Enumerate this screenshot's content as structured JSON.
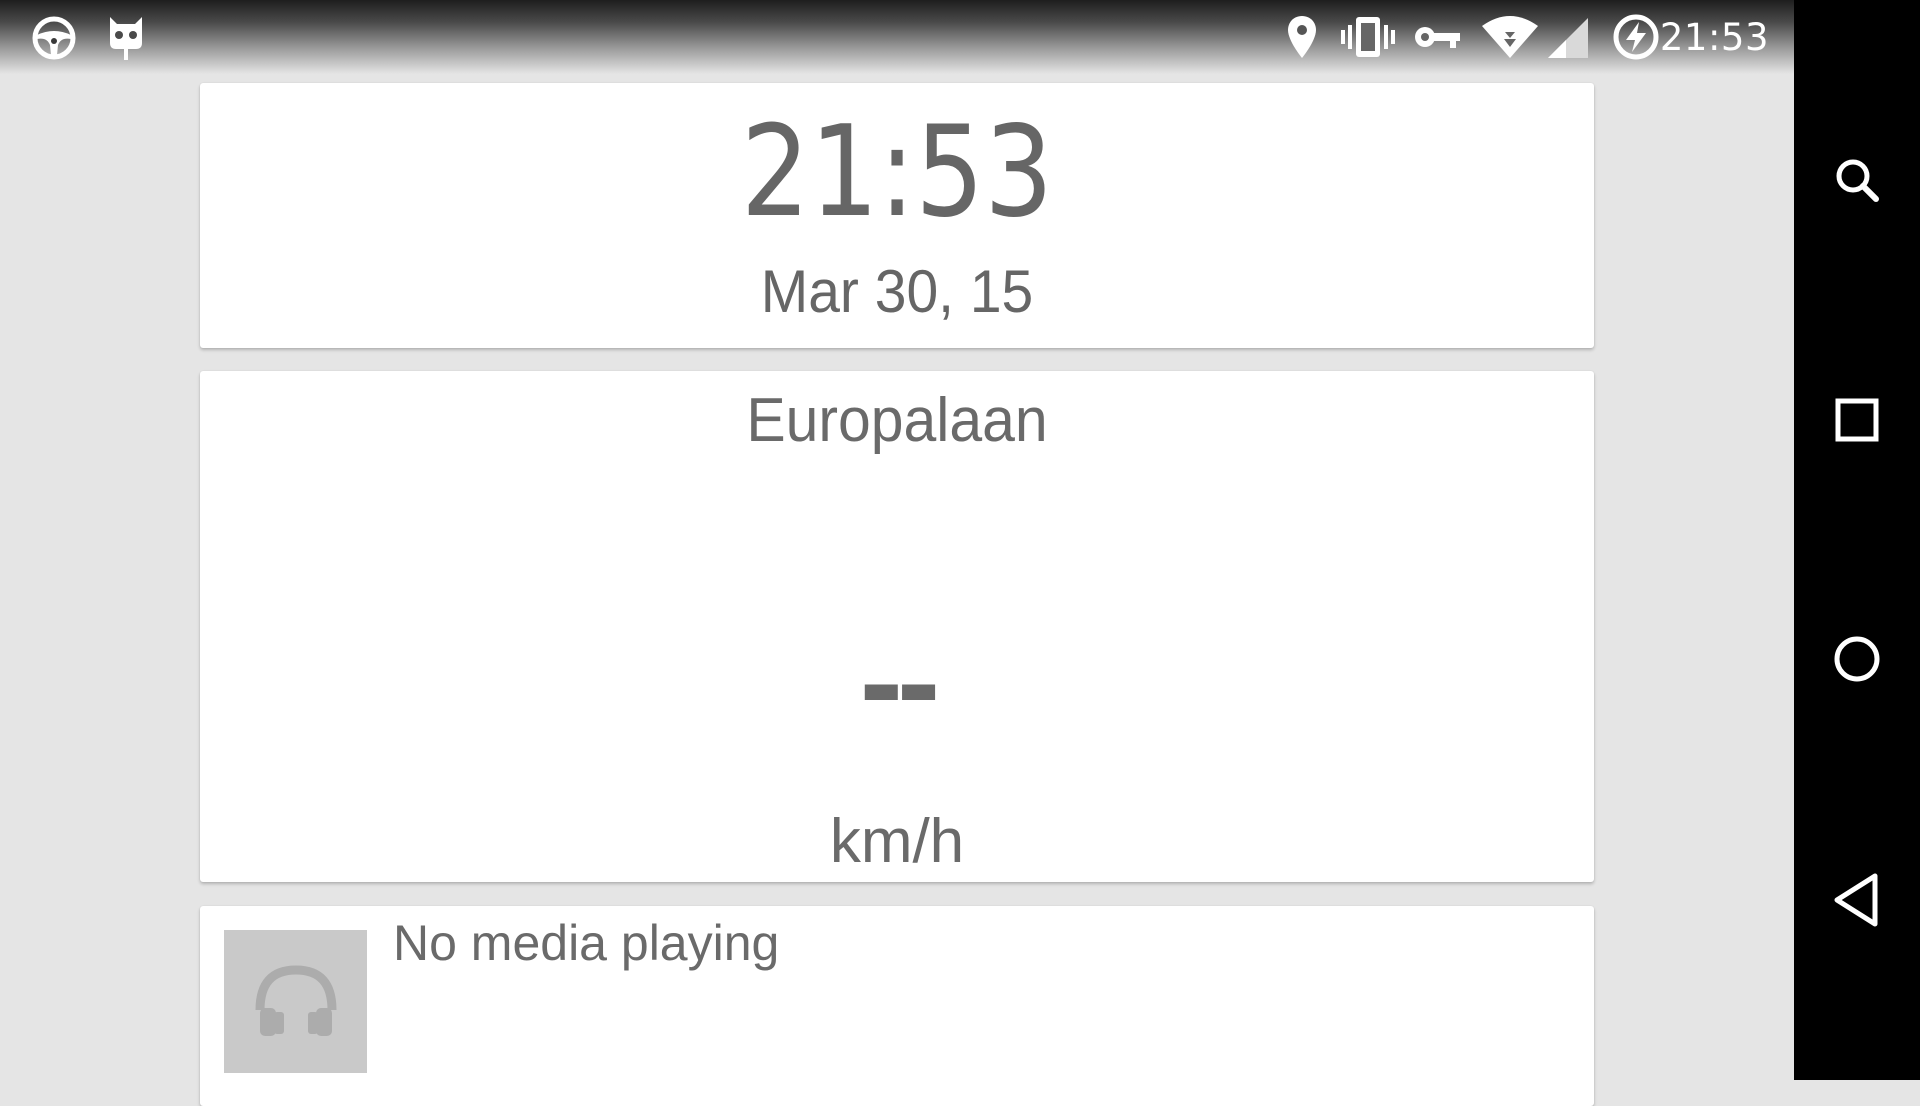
{
  "status_bar": {
    "left_icons": [
      "steering-wheel-icon",
      "cyanogen-mod-icon"
    ],
    "right_icons": [
      "location-icon",
      "vibrate-icon",
      "vpn-key-icon",
      "wifi-icon",
      "cell-signal-icon",
      "battery-charging-icon"
    ],
    "time": "21:53"
  },
  "clock": {
    "time": "21:53",
    "date": "Mar 30, 15"
  },
  "speedometer": {
    "street": "Europalaan",
    "speed": "--",
    "unit": "km/h"
  },
  "media": {
    "status": "No media playing",
    "art_icon": "headphones-icon"
  },
  "nav_bar": {
    "buttons": [
      "search-icon",
      "recents-icon",
      "home-icon",
      "back-icon"
    ]
  },
  "colors": {
    "background": "#e5e5e5",
    "card": "#ffffff",
    "text": "#6a6a6a",
    "nav_bar": "#000000",
    "album_art_placeholder": "#c9c9c9"
  }
}
